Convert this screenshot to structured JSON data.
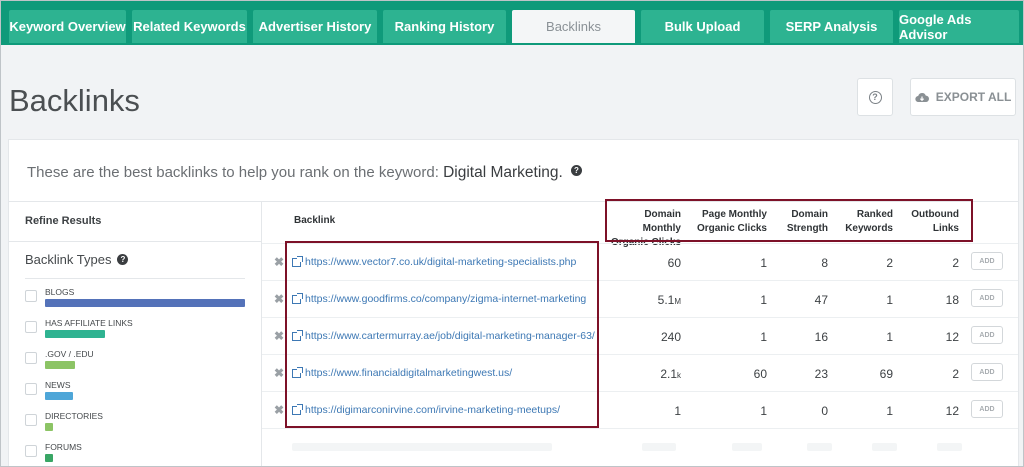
{
  "tabs": [
    {
      "label": "Keyword Overview",
      "active": false
    },
    {
      "label": "Related Keywords",
      "active": false
    },
    {
      "label": "Advertiser History",
      "active": false
    },
    {
      "label": "Ranking History",
      "active": false
    },
    {
      "label": "Backlinks",
      "active": true
    },
    {
      "label": "Bulk Upload",
      "active": false
    },
    {
      "label": "SERP Analysis",
      "active": false
    },
    {
      "label": "Google Ads Advisor",
      "active": false
    }
  ],
  "header": {
    "title": "Backlinks",
    "help_icon": "question-circle-icon",
    "export_label": "EXPORT ALL",
    "export_icon": "cloud-download-icon"
  },
  "intro": {
    "prefix": "These are the best backlinks to help you rank on the keyword:",
    "keyword": "Digital Marketing."
  },
  "sidebar": {
    "title": "Refine Results",
    "section_title": "Backlink Types",
    "types": [
      {
        "label": "BLOGS",
        "color": "#5472b9",
        "fraction": 1.0
      },
      {
        "label": "HAS AFFILIATE LINKS",
        "color": "#2fb391",
        "fraction": 0.3
      },
      {
        "label": ".GOV / .EDU",
        "color": "#8cc465",
        "fraction": 0.15
      },
      {
        "label": "NEWS",
        "color": "#4ea6d8",
        "fraction": 0.14
      },
      {
        "label": "DIRECTORIES",
        "color": "#8cc465",
        "fraction": 0.04
      },
      {
        "label": "FORUMS",
        "color": "#39a665",
        "fraction": 0.04
      }
    ]
  },
  "table": {
    "columns": {
      "backlink": "Backlink",
      "domain_clicks": [
        "Domain Monthly",
        "Organic Clicks"
      ],
      "page_clicks": [
        "Page Monthly",
        "Organic Clicks"
      ],
      "domain_strength": [
        "Domain",
        "Strength"
      ],
      "ranked_keywords": [
        "Ranked",
        "Keywords"
      ],
      "outbound_links": [
        "Outbound",
        "Links"
      ]
    },
    "add_label": "ADD",
    "rows": [
      {
        "url": "https://www.vector7.co.uk/digital-marketing-specialists.php",
        "domain_clicks": "60",
        "domain_unit": "",
        "page_clicks": "1",
        "strength": "8",
        "ranked": "2",
        "outbound": "2"
      },
      {
        "url": "https://www.goodfirms.co/company/zigma-internet-marketing",
        "domain_clicks": "5.1",
        "domain_unit": "M",
        "page_clicks": "1",
        "strength": "47",
        "ranked": "1",
        "outbound": "18"
      },
      {
        "url": "https://www.cartermurray.ae/job/digital-marketing-manager-63/",
        "domain_clicks": "240",
        "domain_unit": "",
        "page_clicks": "1",
        "strength": "16",
        "ranked": "1",
        "outbound": "12"
      },
      {
        "url": "https://www.financialdigitalmarketingwest.us/",
        "domain_clicks": "2.1",
        "domain_unit": "k",
        "page_clicks": "60",
        "strength": "23",
        "ranked": "69",
        "outbound": "2"
      },
      {
        "url": "https://digimarconirvine.com/irvine-marketing-meetups/",
        "domain_clicks": "1",
        "domain_unit": "",
        "page_clicks": "1",
        "strength": "0",
        "ranked": "1",
        "outbound": "12"
      }
    ]
  },
  "colors": {
    "tab_bar": "#0f9a7a",
    "tab": "#2db391",
    "highlight": "#7d1128",
    "link": "#3d78b4"
  }
}
